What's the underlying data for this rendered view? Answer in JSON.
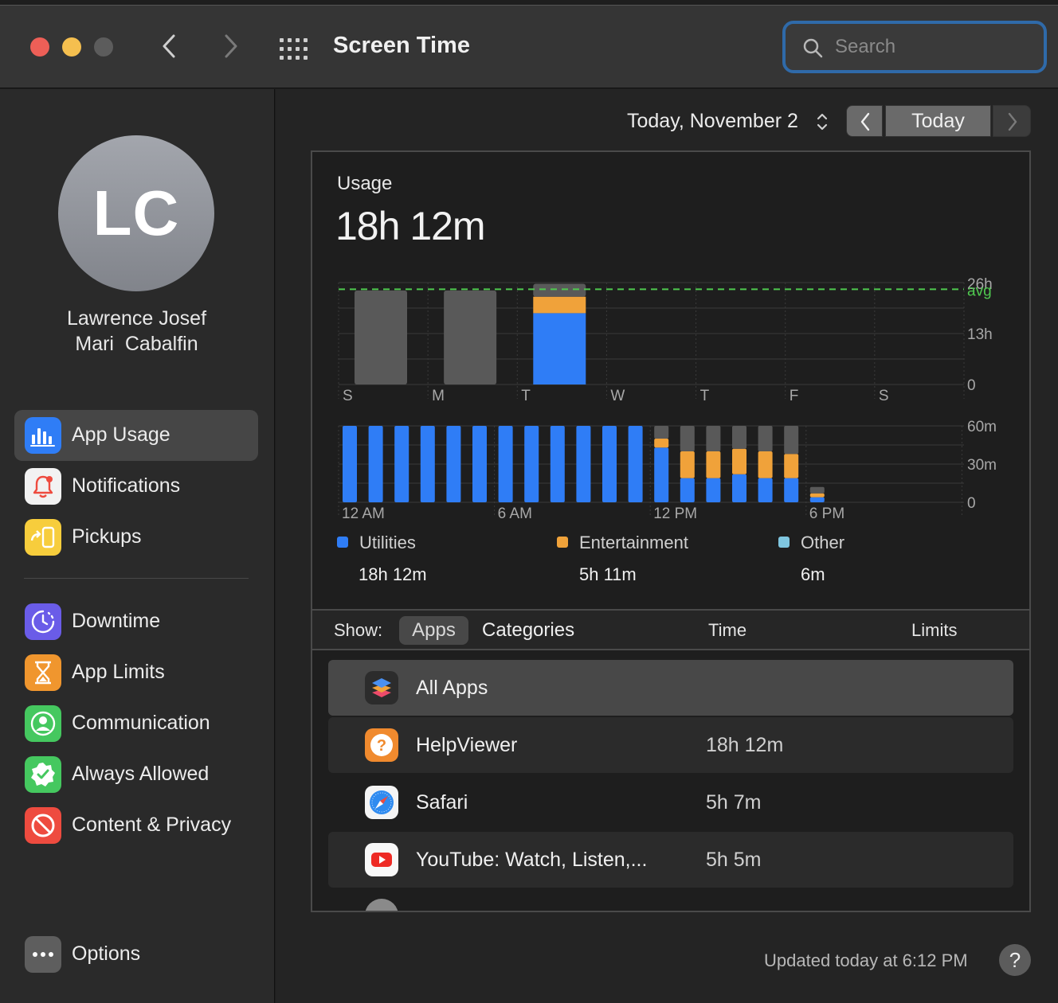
{
  "window": {
    "title": "Screen Time"
  },
  "search": {
    "placeholder": "Search"
  },
  "user": {
    "initials": "LC",
    "name_line1": "Lawrence Josef",
    "name_line2": "Mari  Cabalfin"
  },
  "sidebar": {
    "items": [
      {
        "label": "App Usage",
        "icon": "bar-chart-icon",
        "color": "#2f7df6",
        "selected": true
      },
      {
        "label": "Notifications",
        "icon": "bell-icon",
        "color": "#f2f2f2"
      },
      {
        "label": "Pickups",
        "icon": "pickup-icon",
        "color": "#f7cd3c"
      },
      {
        "label": "Downtime",
        "icon": "downtime-icon",
        "color": "#6a5ce8"
      },
      {
        "label": "App Limits",
        "icon": "hourglass-icon",
        "color": "#f0962e"
      },
      {
        "label": "Communication",
        "icon": "person-icon",
        "color": "#45c85f"
      },
      {
        "label": "Always Allowed",
        "icon": "checkmark-badge-icon",
        "color": "#45c85f"
      },
      {
        "label": "Content & Privacy",
        "icon": "no-entry-icon",
        "color": "#ee4b3f"
      }
    ],
    "options_label": "Options"
  },
  "date": {
    "label": "Today, November 2",
    "today_label": "Today"
  },
  "usage": {
    "label": "Usage",
    "total": "18h 12m"
  },
  "chart_data": [
    {
      "type": "bar",
      "stacked": true,
      "categories": [
        "S",
        "M",
        "T",
        "W",
        "T",
        "F",
        "S"
      ],
      "series": [
        {
          "name": "Utilities",
          "color": "#2f7df6",
          "values": [
            0,
            0,
            18.2,
            0,
            0,
            0,
            0
          ]
        },
        {
          "name": "Entertainment",
          "color": "#f0a23a",
          "values": [
            0,
            0,
            4.2,
            0,
            0,
            0,
            0
          ]
        },
        {
          "name": "Other",
          "color": "#595959",
          "values": [
            24,
            24,
            3.3,
            0,
            0,
            0,
            0
          ]
        }
      ],
      "yticks": [
        "26h",
        "13h",
        "0"
      ],
      "ylim": [
        0,
        26
      ],
      "average": {
        "label": "avg",
        "value": 24.3,
        "color": "#4fc94f"
      },
      "grid": true
    },
    {
      "type": "bar",
      "stacked": true,
      "categories": [
        "0",
        "1",
        "2",
        "3",
        "4",
        "5",
        "6",
        "7",
        "8",
        "9",
        "10",
        "11",
        "12",
        "13",
        "14",
        "15",
        "16",
        "17",
        "18"
      ],
      "xtick_labels": [
        "12 AM",
        "6 AM",
        "12 PM",
        "6 PM"
      ],
      "series": [
        {
          "name": "Utilities",
          "color": "#2f7df6",
          "values": [
            60,
            60,
            60,
            60,
            60,
            60,
            60,
            60,
            60,
            60,
            60,
            60,
            43,
            19,
            19,
            22,
            19,
            19,
            4
          ]
        },
        {
          "name": "Entertainment",
          "color": "#f0a23a",
          "values": [
            0,
            0,
            0,
            0,
            0,
            0,
            0,
            0,
            0,
            0,
            0,
            0,
            7,
            21,
            21,
            20,
            21,
            19,
            3
          ]
        },
        {
          "name": "Other",
          "color": "#595959",
          "values": [
            0,
            0,
            0,
            0,
            0,
            0,
            0,
            0,
            0,
            0,
            0,
            0,
            10,
            20,
            20,
            18,
            20,
            22,
            5
          ]
        }
      ],
      "yticks": [
        "60m",
        "30m",
        "0"
      ],
      "ylim": [
        0,
        60
      ],
      "grid": true
    }
  ],
  "legend": [
    {
      "name": "Utilities",
      "value": "18h 12m",
      "color": "#2f7df6"
    },
    {
      "name": "Entertainment",
      "value": "5h 11m",
      "color": "#f0a23a"
    },
    {
      "name": "Other",
      "value": "6m",
      "color": "#7fc6e0"
    }
  ],
  "show_bar": {
    "label": "Show:",
    "apps": "Apps",
    "categories": "Categories",
    "time_col": "Time",
    "limits_col": "Limits"
  },
  "apps": [
    {
      "name": "All Apps",
      "time": "",
      "icon": "stack-icon"
    },
    {
      "name": "HelpViewer",
      "time": "18h 12m",
      "icon": "help-viewer-icon"
    },
    {
      "name": "Safari",
      "time": "5h 7m",
      "icon": "safari-icon"
    },
    {
      "name": "YouTube: Watch, Listen,...",
      "time": "5h 5m",
      "icon": "youtube-icon"
    }
  ],
  "footer": {
    "updated": "Updated today at 6:12 PM",
    "help": "?"
  }
}
